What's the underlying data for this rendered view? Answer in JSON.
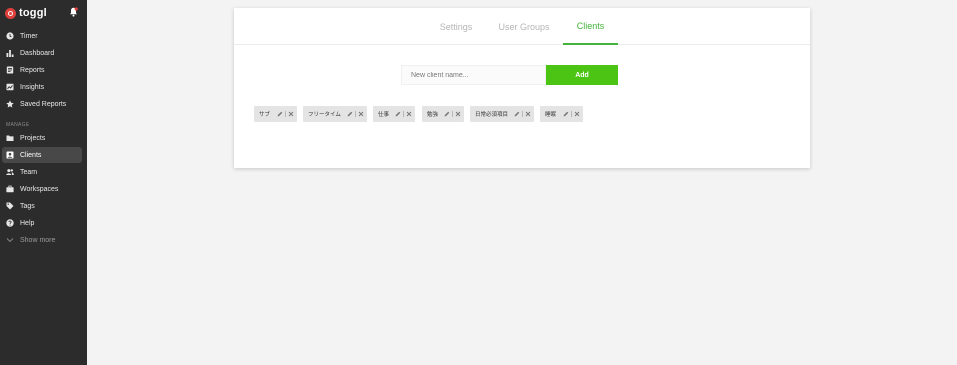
{
  "app": {
    "brand": "toggl"
  },
  "sidebar": {
    "items": [
      {
        "label": "Timer",
        "icon": "clock-icon"
      },
      {
        "label": "Dashboard",
        "icon": "bar-chart-icon"
      },
      {
        "label": "Reports",
        "icon": "report-icon"
      },
      {
        "label": "Insights",
        "icon": "insights-icon"
      },
      {
        "label": "Saved Reports",
        "icon": "star-icon"
      }
    ],
    "section_label": "MANAGE",
    "manage_items": [
      {
        "label": "Projects",
        "icon": "folder-icon",
        "active": false
      },
      {
        "label": "Clients",
        "icon": "client-icon",
        "active": true
      },
      {
        "label": "Team",
        "icon": "team-icon",
        "active": false
      },
      {
        "label": "Workspaces",
        "icon": "briefcase-icon",
        "active": false
      },
      {
        "label": "Tags",
        "icon": "tag-icon",
        "active": false
      },
      {
        "label": "Help",
        "icon": "help-icon",
        "active": false
      }
    ],
    "show_more": "Show more"
  },
  "tabs": [
    {
      "label": "Settings",
      "active": false
    },
    {
      "label": "User Groups",
      "active": false
    },
    {
      "label": "Clients",
      "active": true
    }
  ],
  "client_form": {
    "placeholder": "New client name...",
    "add_label": "Add"
  },
  "clients": [
    {
      "name": "サブ"
    },
    {
      "name": "フリータイム"
    },
    {
      "name": "仕事"
    },
    {
      "name": "勉強"
    },
    {
      "name": "日常必須項目"
    },
    {
      "name": "睡眠"
    }
  ],
  "colors": {
    "sidebar_bg": "#2c2c2c",
    "accent_green": "#44b33b",
    "add_button": "#4cc413",
    "brand_red": "#e0403c"
  }
}
